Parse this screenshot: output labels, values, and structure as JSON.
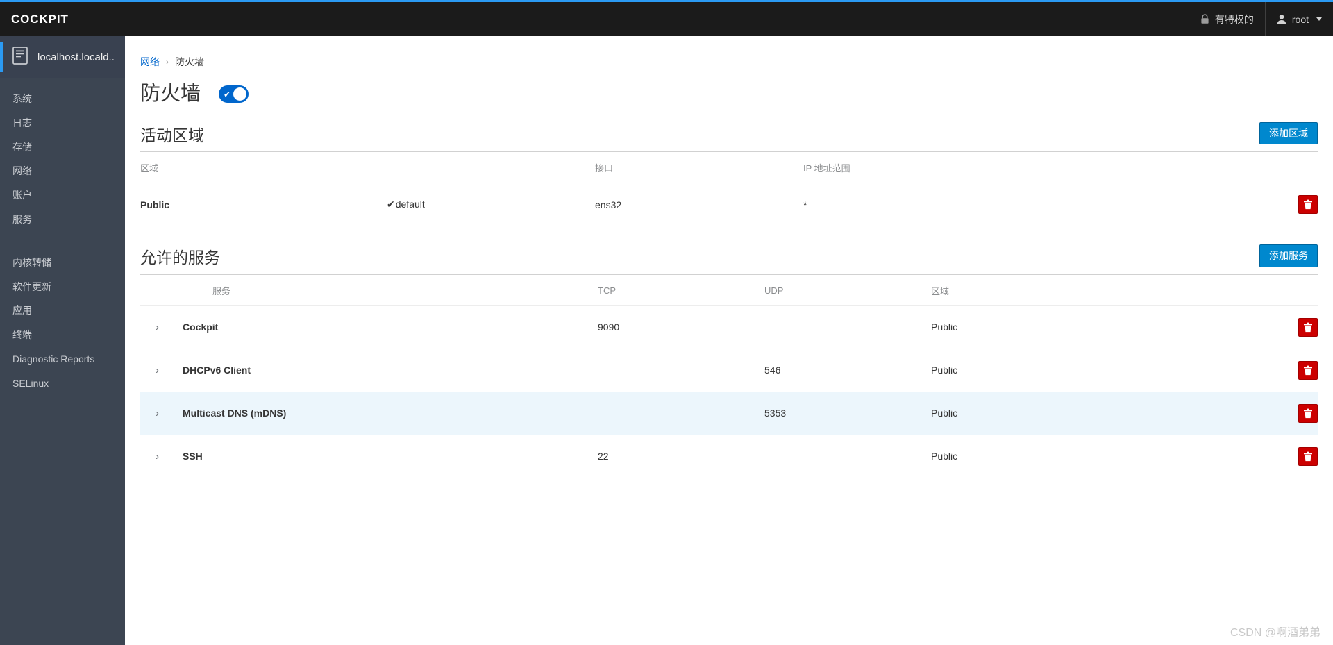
{
  "brand": "COCKPIT",
  "masthead": {
    "privileged_label": "有特权的",
    "privileged_icon": "lock-icon",
    "user_label": "root",
    "user_icon": "user-icon",
    "caret_icon": "chevron-down-icon"
  },
  "sidebar": {
    "host": {
      "label": "localhost.locald...",
      "icon": "server-icon"
    },
    "groups": [
      {
        "items": [
          {
            "label": "系统"
          },
          {
            "label": "日志"
          },
          {
            "label": "存储"
          },
          {
            "label": "网络"
          },
          {
            "label": "账户"
          },
          {
            "label": "服务"
          }
        ]
      },
      {
        "items": [
          {
            "label": "内核转储"
          },
          {
            "label": "软件更新"
          },
          {
            "label": "应用"
          },
          {
            "label": "终端"
          },
          {
            "label": "Diagnostic Reports"
          },
          {
            "label": "SELinux"
          }
        ]
      }
    ]
  },
  "breadcrumb": {
    "parent": "网络",
    "separator": "›",
    "current": "防火墙"
  },
  "page": {
    "title": "防火墙",
    "toggle": {
      "state": "on",
      "check_glyph": "✔"
    }
  },
  "zones_section": {
    "title": "活动区域",
    "add_button": "添加区域",
    "columns": [
      "区域",
      "接口",
      "IP 地址范围",
      ""
    ],
    "rows": [
      {
        "zone": "Public",
        "default_tick": "✔",
        "default_label": "default",
        "interface": "ens32",
        "ip_range": "*",
        "delete_icon": "trash-icon"
      }
    ]
  },
  "services_section": {
    "title": "允许的服务",
    "add_button": "添加服务",
    "columns": [
      "",
      "服务",
      "TCP",
      "UDP",
      "区域",
      ""
    ],
    "expander_glyph": "›",
    "rows": [
      {
        "service": "Cockpit",
        "tcp": "9090",
        "udp": "",
        "zone": "Public",
        "highlighted": false,
        "delete_icon": "trash-icon"
      },
      {
        "service": "DHCPv6 Client",
        "tcp": "",
        "udp": "546",
        "zone": "Public",
        "highlighted": false,
        "delete_icon": "trash-icon"
      },
      {
        "service": "Multicast DNS (mDNS)",
        "tcp": "",
        "udp": "5353",
        "zone": "Public",
        "highlighted": true,
        "delete_icon": "trash-icon"
      },
      {
        "service": "SSH",
        "tcp": "22",
        "udp": "",
        "zone": "Public",
        "highlighted": false,
        "delete_icon": "trash-icon"
      }
    ]
  },
  "watermark": "CSDN @啊酒弟弟",
  "colors": {
    "accent": "#2b9af3",
    "primary_button": "#0088ce",
    "danger_button": "#cc0000",
    "masthead_bg": "#1b1b1b",
    "sidebar_bg": "#3c4552",
    "row_highlight": "#ecf6fc",
    "link": "#0066cc"
  }
}
